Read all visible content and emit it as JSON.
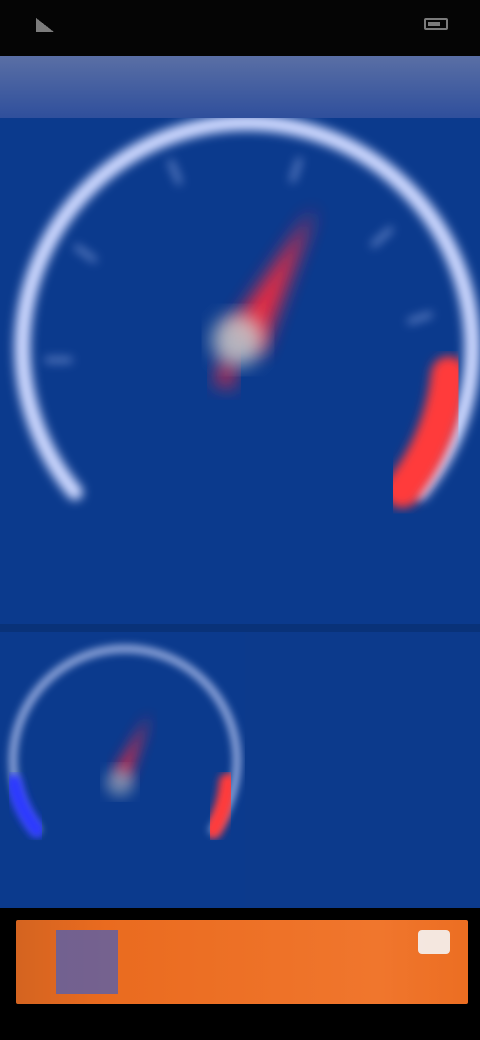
{
  "status_bar": {
    "left_text": "",
    "right_text": ""
  },
  "title_bar": {
    "title": ""
  },
  "main_gauge": {
    "value": "",
    "unit": "",
    "colors": {
      "ring": "#cdd8ff",
      "redline": "#ff3a3a",
      "needle": "#ff2a3a",
      "background": "#0b3a8d"
    }
  },
  "small_gauge": {
    "value": "",
    "colors": {
      "ring": "#cdd8ff",
      "low_zone": "#2a37ff",
      "redline": "#ff3a3a"
    }
  },
  "info_panel": {
    "label": "",
    "value": "",
    "unit": ""
  },
  "action_button": {
    "label": "",
    "colors": {
      "background": "#ec6e22",
      "icon_box": "#4e5fb5"
    }
  }
}
